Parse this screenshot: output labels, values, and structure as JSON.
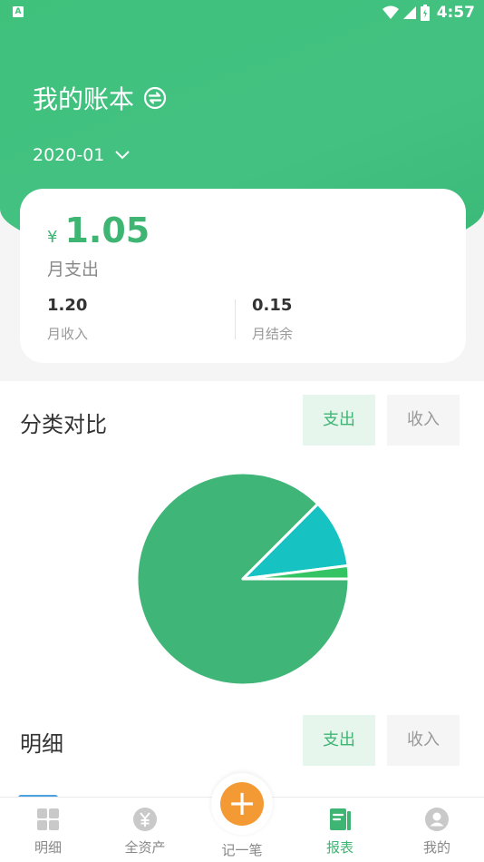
{
  "status_bar": {
    "app_badge": "A",
    "time": "4:57"
  },
  "header": {
    "title": "我的账本",
    "date": "2020-01"
  },
  "summary": {
    "currency": "¥",
    "expense": "1.05",
    "expense_label": "月支出",
    "income": "1.20",
    "income_label": "月收入",
    "balance": "0.15",
    "balance_label": "月结余"
  },
  "category": {
    "title": "分类对比",
    "tab_expense": "支出",
    "tab_income": "收入"
  },
  "chart_data": {
    "type": "pie",
    "slices": [
      {
        "value": 87.5,
        "color": "#3fb577"
      },
      {
        "value": 10.5,
        "color": "#17c2c2"
      },
      {
        "value": 2.0,
        "color": "#34c463"
      }
    ]
  },
  "detail": {
    "title": "明细",
    "tab_expense": "支出",
    "tab_income": "收入"
  },
  "tabbar": {
    "detail": "明细",
    "assets": "全资产",
    "add": "记一笔",
    "report": "报表",
    "mine": "我的",
    "active": "report"
  }
}
